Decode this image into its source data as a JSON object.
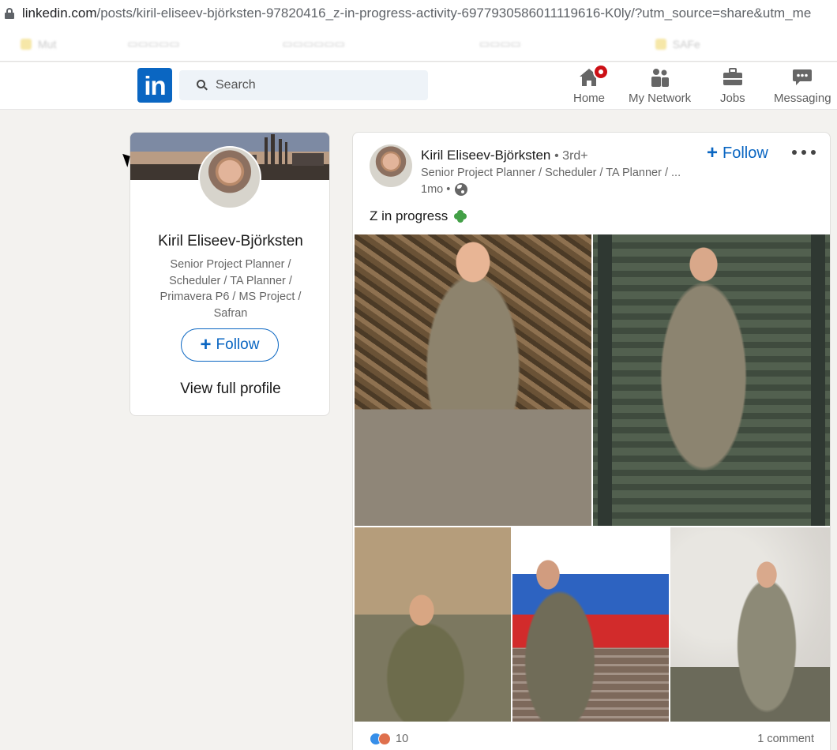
{
  "browser": {
    "url_host": "linkedin.com",
    "url_path": "/posts/kiril-eliseev-björksten-97820416_z-in-progress-activity-6977930586011119616-K0ly/?utm_source=share&utm_me",
    "bookmarks": [
      "Mut",
      "",
      "",
      "",
      "SAFe"
    ]
  },
  "header": {
    "logo_text": "in",
    "search_placeholder": "Search",
    "nav": [
      {
        "label": "Home",
        "icon": "home-icon"
      },
      {
        "label": "My Network",
        "icon": "network-icon"
      },
      {
        "label": "Jobs",
        "icon": "briefcase-icon"
      },
      {
        "label": "Messaging",
        "icon": "messaging-icon"
      }
    ]
  },
  "profile_card": {
    "name": "Kiril Eliseev-Björksten",
    "headline": "Senior Project Planner / Scheduler / TA Planner / Primavera P6 / MS Project / Safran",
    "follow_label": "Follow",
    "view_profile_label": "View full profile"
  },
  "post": {
    "author_name": "Kiril Eliseev-Björksten",
    "degree": "• 3rd+",
    "author_headline": "Senior Project Planner / Scheduler / TA Planner / ...",
    "time": "1mo •",
    "follow_label": "Follow",
    "text": "Z in progress",
    "reaction_count": "10",
    "comments_label": "1 comment"
  },
  "colors": {
    "linkedin_blue": "#0a66c2",
    "notification_red": "#cc1016",
    "page_background": "#f3f2ef"
  }
}
